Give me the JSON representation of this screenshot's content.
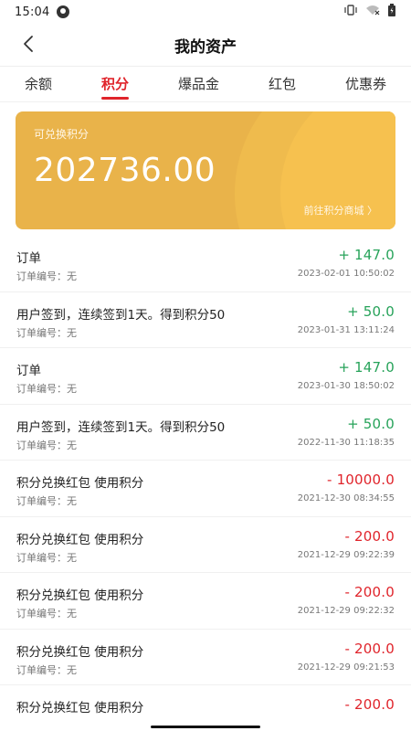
{
  "status_bar": {
    "time": "15:04"
  },
  "header": {
    "title": "我的资产"
  },
  "tabs": [
    {
      "label": "余额",
      "active": false
    },
    {
      "label": "积分",
      "active": true
    },
    {
      "label": "爆品金",
      "active": false
    },
    {
      "label": "红包",
      "active": false
    },
    {
      "label": "优惠券",
      "active": false
    }
  ],
  "card": {
    "label": "可兑换积分",
    "amount": "202736.00",
    "link": "前往积分商城 〉"
  },
  "records": [
    {
      "name": "订单",
      "order": "订单编号：无",
      "amount": "+ 147.0",
      "sign": "plus",
      "time": "2023-02-01 10:50:02"
    },
    {
      "name": "用户签到，连续签到1天。得到积分50",
      "order": "订单编号：无",
      "amount": "+ 50.0",
      "sign": "plus",
      "time": "2023-01-31 13:11:24"
    },
    {
      "name": "订单",
      "order": "订单编号：无",
      "amount": "+ 147.0",
      "sign": "plus",
      "time": "2023-01-30 18:50:02"
    },
    {
      "name": "用户签到，连续签到1天。得到积分50",
      "order": "订单编号：无",
      "amount": "+ 50.0",
      "sign": "plus",
      "time": "2022-11-30 11:18:35"
    },
    {
      "name": "积分兑换红包 使用积分",
      "order": "订单编号：无",
      "amount": "- 10000.0",
      "sign": "minus",
      "time": "2021-12-30 08:34:55"
    },
    {
      "name": "积分兑换红包 使用积分",
      "order": "订单编号：无",
      "amount": "- 200.0",
      "sign": "minus",
      "time": "2021-12-29 09:22:39"
    },
    {
      "name": "积分兑换红包 使用积分",
      "order": "订单编号：无",
      "amount": "- 200.0",
      "sign": "minus",
      "time": "2021-12-29 09:22:32"
    },
    {
      "name": "积分兑换红包 使用积分",
      "order": "订单编号：无",
      "amount": "- 200.0",
      "sign": "minus",
      "time": "2021-12-29 09:21:53"
    },
    {
      "name": "积分兑换红包 使用积分",
      "order": "",
      "amount": "- 200.0",
      "sign": "minus",
      "time": ""
    }
  ],
  "colors": {
    "accent": "#e0242b",
    "plus": "#27a35a",
    "card": "#e9b34a"
  }
}
